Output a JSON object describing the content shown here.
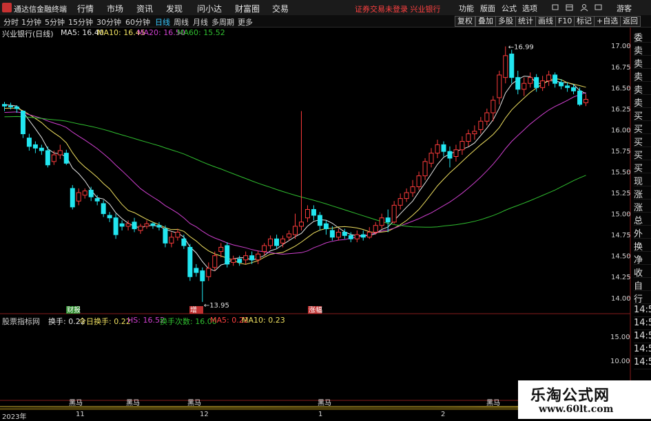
{
  "app": {
    "name": "通达信金融终端"
  },
  "menu": [
    "行情",
    "市场",
    "资讯",
    "发现",
    "问小达",
    "财富圈",
    "交易"
  ],
  "notice": "证券交易未登录  兴业银行",
  "menu_right": [
    "功能",
    "版面",
    "公式",
    "选项",
    "游客"
  ],
  "periods": [
    "分时",
    "1分钟",
    "5分钟",
    "15分钟",
    "30分钟",
    "60分钟",
    "日线",
    "周线",
    "月线",
    "多周期",
    "更多"
  ],
  "active_period": "日线",
  "tools": [
    "复权",
    "叠加",
    "多股",
    "统计",
    "画线",
    "F10",
    "标记",
    "+自选",
    "返回"
  ],
  "info": {
    "title": "兴业银行(日线)",
    "ma5": "MA5: 16.40",
    "ma10": "MA10: 16.45",
    "ma20": "MA20: 16.50",
    "ma60": "MA60: 15.52"
  },
  "price_labels": [
    "17.00",
    "16.75",
    "16.50",
    "16.25",
    "16.00",
    "15.75",
    "15.50",
    "15.25",
    "15.00",
    "14.75",
    "14.50",
    "14.25",
    "14.00"
  ],
  "annotations": {
    "high": "16.99",
    "low": "13.95"
  },
  "markers": [
    "财报",
    "增",
    "涨幅"
  ],
  "right_panel": [
    "委比",
    "卖五",
    "卖四",
    "卖三",
    "卖二",
    "卖一",
    "买一",
    "买二",
    "买三",
    "买四",
    "买五",
    "现价",
    "涨跌",
    "涨幅",
    "总量",
    "外盘",
    "换手",
    "净资",
    "收益",
    "自动",
    "行情",
    "14:5",
    "14:5",
    "14:5",
    "14:5",
    "14:5"
  ],
  "indicator": {
    "name": "股票指标网",
    "huanshou": "换手: 0.22",
    "today": "今日换手: 0.22",
    "hs": "HS: 16.52",
    "count": "换手次数: 16.00",
    "ma5": "MA5: 0.22",
    "ma10": "MA10: 0.23",
    "labels": [
      "15.00",
      "10.00"
    ]
  },
  "heima": [
    "黑马",
    "黑马",
    "黑马",
    "黑马",
    "黑马"
  ],
  "dates": [
    "2023年",
    "11",
    "12",
    "1",
    "2"
  ],
  "watermark": {
    "title": "乐淘公式网",
    "url": "www.60lt.com"
  },
  "colors": {
    "up": "#ff3c3c",
    "down": "#22e6f0",
    "ma5": "#e8e8e8",
    "ma10": "#f0e060",
    "ma20": "#d040d0",
    "ma60": "#30c030",
    "accent": "#38c8ff"
  },
  "chart_data": {
    "type": "candlestick",
    "ylim": [
      13.9,
      17.1
    ],
    "candles": [
      [
        16.3,
        16.28,
        16.33,
        16.22
      ],
      [
        16.28,
        16.27,
        16.32,
        16.24
      ],
      [
        16.27,
        16.25,
        16.29,
        16.2
      ],
      [
        16.22,
        15.95,
        16.23,
        15.9
      ],
      [
        15.9,
        15.8,
        15.95,
        15.75
      ],
      [
        15.82,
        15.78,
        15.86,
        15.72
      ],
      [
        15.78,
        15.75,
        15.82,
        15.7
      ],
      [
        15.75,
        15.58,
        15.8,
        15.55
      ],
      [
        15.62,
        15.7,
        15.75,
        15.58
      ],
      [
        15.7,
        15.75,
        15.82,
        15.65
      ],
      [
        15.72,
        15.6,
        15.76,
        15.58
      ],
      [
        15.3,
        15.08,
        15.34,
        15.05
      ],
      [
        15.15,
        15.25,
        15.3,
        15.1
      ],
      [
        15.22,
        15.27,
        15.3,
        15.18
      ],
      [
        15.28,
        15.2,
        15.32,
        15.15
      ],
      [
        15.18,
        15.15,
        15.22,
        15.1
      ],
      [
        15.12,
        15.0,
        15.16,
        14.96
      ],
      [
        14.98,
        14.95,
        15.02,
        14.9
      ],
      [
        14.95,
        14.75,
        15.0,
        14.7
      ],
      [
        14.88,
        14.85,
        14.92,
        14.8
      ],
      [
        14.85,
        14.88,
        14.92,
        14.8
      ],
      [
        14.9,
        14.82,
        14.95,
        14.78
      ],
      [
        14.8,
        14.85,
        14.88,
        14.76
      ],
      [
        14.85,
        14.88,
        14.92,
        14.82
      ],
      [
        14.88,
        14.86,
        14.9,
        14.82
      ],
      [
        14.86,
        14.84,
        14.9,
        14.8
      ],
      [
        14.82,
        14.65,
        14.86,
        14.6
      ],
      [
        14.65,
        14.72,
        14.78,
        14.6
      ],
      [
        14.72,
        14.78,
        14.82,
        14.68
      ],
      [
        14.7,
        14.62,
        14.75,
        14.58
      ],
      [
        14.6,
        14.25,
        14.64,
        14.2
      ],
      [
        14.35,
        14.3,
        14.4,
        14.25
      ],
      [
        14.32,
        14.2,
        14.36,
        13.95
      ],
      [
        14.25,
        14.35,
        14.42,
        14.2
      ],
      [
        14.36,
        14.5,
        14.55,
        14.32
      ],
      [
        14.55,
        14.6,
        14.65,
        14.48
      ],
      [
        14.62,
        14.4,
        14.66,
        14.36
      ],
      [
        14.42,
        14.46,
        14.5,
        14.38
      ],
      [
        14.46,
        14.42,
        14.5,
        14.38
      ],
      [
        14.45,
        14.5,
        14.55,
        14.4
      ],
      [
        14.5,
        14.45,
        14.55,
        14.4
      ],
      [
        14.45,
        14.52,
        14.56,
        14.4
      ],
      [
        14.55,
        14.62,
        14.65,
        14.5
      ],
      [
        14.62,
        14.7,
        14.74,
        14.58
      ],
      [
        14.7,
        14.62,
        14.75,
        14.58
      ],
      [
        14.65,
        14.7,
        14.74,
        14.6
      ],
      [
        14.72,
        14.76,
        14.8,
        14.68
      ],
      [
        14.75,
        14.85,
        15.0,
        14.7
      ],
      [
        14.85,
        14.9,
        16.22,
        14.8
      ],
      [
        14.95,
        15.05,
        15.1,
        14.9
      ],
      [
        15.05,
        14.98,
        15.1,
        14.92
      ],
      [
        14.98,
        14.86,
        15.02,
        14.8
      ],
      [
        14.88,
        14.82,
        14.92,
        14.75
      ],
      [
        14.8,
        14.72,
        14.85,
        14.68
      ],
      [
        14.72,
        14.78,
        14.82,
        14.68
      ],
      [
        14.78,
        14.74,
        14.82,
        14.7
      ],
      [
        14.74,
        14.7,
        14.78,
        14.66
      ],
      [
        14.7,
        14.75,
        14.8,
        14.66
      ],
      [
        14.75,
        14.72,
        14.8,
        14.68
      ],
      [
        14.72,
        14.78,
        14.84,
        14.7
      ],
      [
        14.78,
        14.86,
        14.9,
        14.75
      ],
      [
        14.86,
        14.95,
        15.0,
        14.82
      ],
      [
        14.95,
        14.9,
        15.05,
        14.78
      ],
      [
        14.9,
        15.1,
        15.15,
        14.88
      ],
      [
        15.1,
        15.18,
        15.24,
        15.05
      ],
      [
        15.18,
        15.25,
        15.3,
        15.14
      ],
      [
        15.25,
        15.32,
        15.4,
        15.2
      ],
      [
        15.32,
        15.45,
        15.5,
        15.28
      ],
      [
        15.45,
        15.62,
        15.66,
        15.4
      ],
      [
        15.6,
        15.72,
        15.78,
        15.55
      ],
      [
        15.72,
        15.82,
        15.88,
        15.66
      ],
      [
        15.82,
        15.74,
        15.86,
        15.68
      ],
      [
        15.74,
        15.66,
        15.8,
        15.55
      ],
      [
        15.68,
        15.76,
        15.82,
        15.62
      ],
      [
        15.76,
        15.86,
        15.92,
        15.7
      ],
      [
        15.86,
        15.95,
        16.0,
        15.8
      ],
      [
        15.95,
        15.98,
        16.05,
        15.88
      ],
      [
        16.0,
        16.1,
        16.15,
        15.95
      ],
      [
        16.1,
        16.2,
        16.25,
        16.05
      ],
      [
        16.2,
        16.35,
        16.4,
        16.1
      ],
      [
        16.38,
        16.65,
        16.7,
        16.3
      ],
      [
        16.62,
        16.88,
        16.99,
        16.55
      ],
      [
        16.9,
        16.62,
        16.95,
        16.55
      ],
      [
        16.62,
        16.48,
        16.7,
        16.42
      ],
      [
        16.48,
        16.55,
        16.62,
        16.4
      ],
      [
        16.55,
        16.62,
        16.68,
        16.5
      ],
      [
        16.62,
        16.5,
        16.66,
        16.45
      ],
      [
        16.5,
        16.58,
        16.64,
        16.46
      ],
      [
        16.58,
        16.65,
        16.7,
        16.52
      ],
      [
        16.65,
        16.55,
        16.68,
        16.5
      ],
      [
        16.56,
        16.52,
        16.6,
        16.48
      ],
      [
        16.52,
        16.5,
        16.56,
        16.45
      ],
      [
        16.5,
        16.46,
        16.54,
        16.42
      ],
      [
        16.46,
        16.3,
        16.5,
        16.28
      ],
      [
        16.32,
        16.36,
        16.42,
        16.28
      ]
    ]
  }
}
